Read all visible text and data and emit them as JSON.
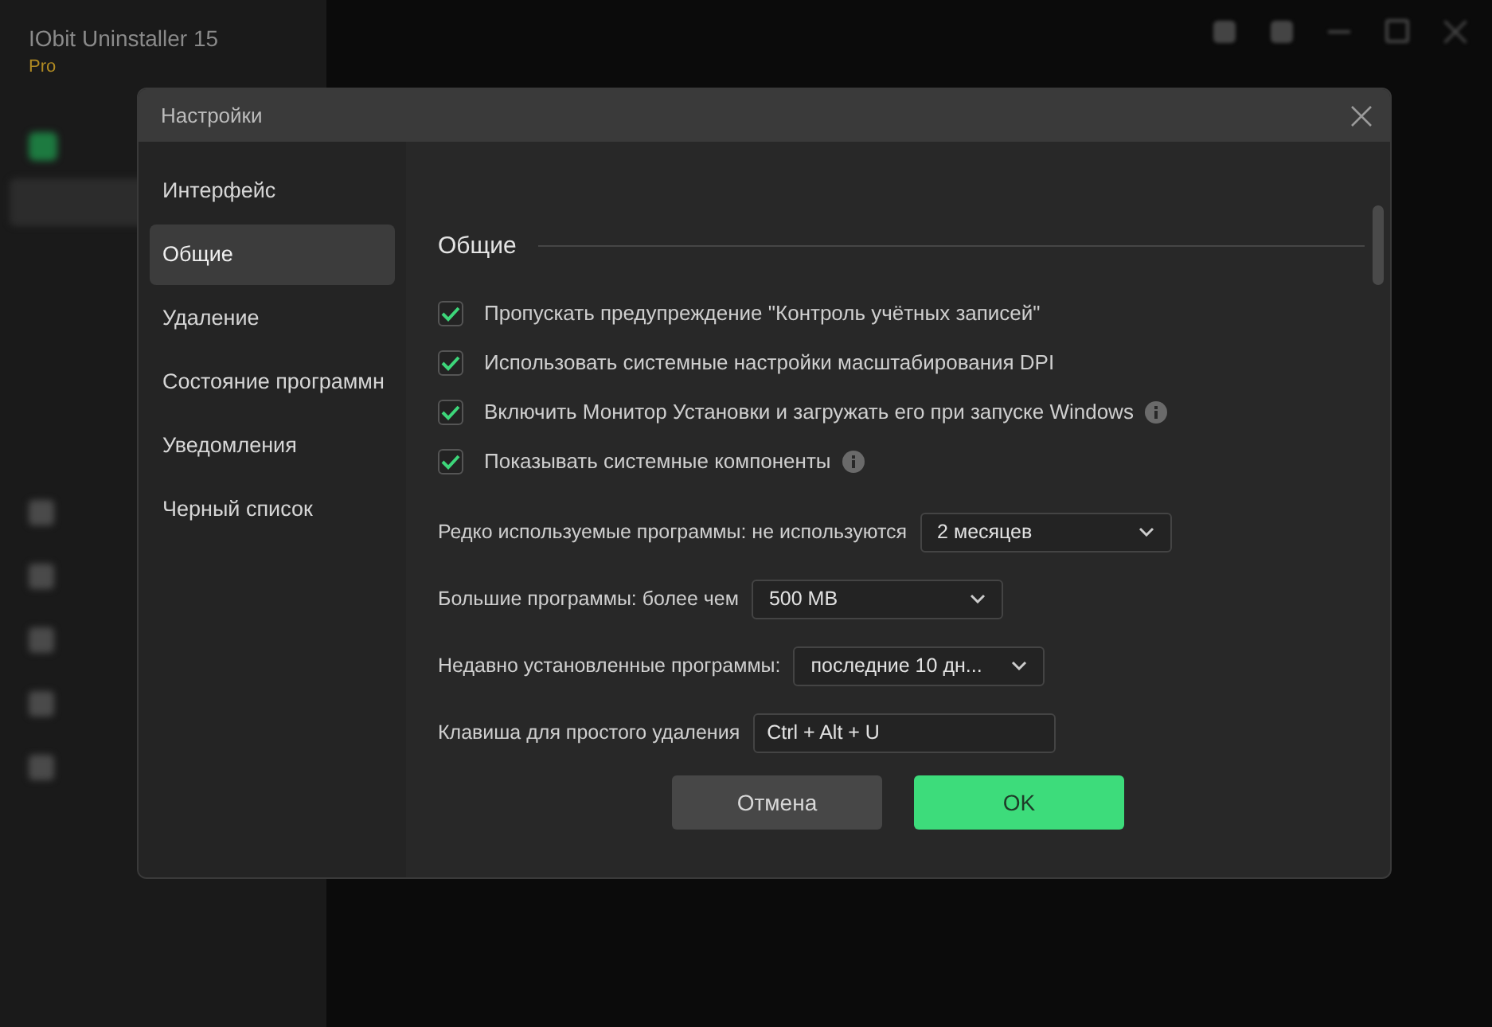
{
  "app": {
    "title": "IObit Uninstaller 15",
    "edition": "Pro"
  },
  "dialog": {
    "title": "Настройки",
    "nav": [
      {
        "label": "Интерфейс",
        "selected": false
      },
      {
        "label": "Общие",
        "selected": true
      },
      {
        "label": "Удаление",
        "selected": false
      },
      {
        "label": "Состояние программн",
        "selected": false
      },
      {
        "label": "Уведомления",
        "selected": false
      },
      {
        "label": "Черный список",
        "selected": false
      }
    ],
    "section_title": "Общие",
    "options": [
      {
        "label": "Пропускать предупреждение \"Контроль учётных записей\"",
        "checked": true,
        "info": false
      },
      {
        "label": "Использовать системные настройки масштабирования DPI",
        "checked": true,
        "info": false
      },
      {
        "label": "Включить Монитор Установки и загружать его при запуске Windows",
        "checked": true,
        "info": true
      },
      {
        "label": "Показывать системные компоненты",
        "checked": true,
        "info": true
      }
    ],
    "settings": [
      {
        "kind": "select",
        "label": "Редко используемые программы: не используются",
        "value": "2 месяцев"
      },
      {
        "kind": "select",
        "label": "Большие программы: более чем",
        "value": "500 MB"
      },
      {
        "kind": "select",
        "label": "Недавно установленные программы:",
        "value": "последние 10 дн..."
      },
      {
        "kind": "field",
        "label": "Клавиша для простого удаления",
        "value": "Ctrl + Alt + U"
      }
    ],
    "buttons": [
      {
        "label": "Отмена",
        "kind": "secondary"
      },
      {
        "label": "OK",
        "kind": "primary"
      }
    ]
  }
}
